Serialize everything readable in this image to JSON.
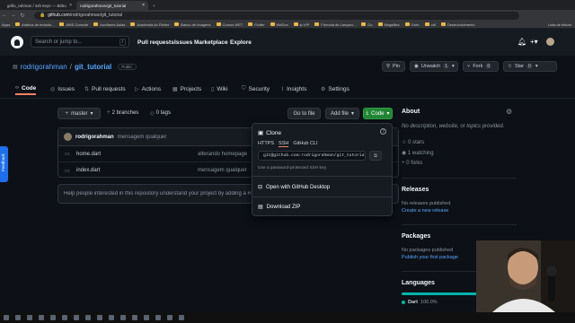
{
  "browser": {
    "tabs": [
      {
        "title": "grillo_rahman / ssh keys — Bitbu",
        "active": false
      },
      {
        "title": "rodrigorahman/git_tutorial",
        "active": true
      }
    ],
    "url_host": "github.com",
    "url_path": "/rodrigorahman/git_tutorial",
    "bookmarks": [
      "Apps",
      "Atalhos de teclado...",
      "AWS Console",
      "Auxiliares Aulas",
      "Academia do Flutter",
      "Banco de Imagens",
      "Cursos WET",
      "Flutter",
      "WeDox",
      "ip VIP",
      "Fórmula de Lançam...",
      "Go",
      "Megafiles",
      "Grêo",
      "old",
      "Desenvolvimento",
      "Lista de leitura"
    ]
  },
  "header": {
    "search_placeholder": "Search or jump to...",
    "search_kbd": "/",
    "nav": [
      "Pull requests",
      "Issues",
      "Marketplace",
      "Explore"
    ]
  },
  "repo": {
    "owner": "rodrigorahman",
    "sep": "/",
    "name": "git_tutorial",
    "visibility": "Public",
    "pin_label": "Pin",
    "unwatch_label": "Unwatch",
    "unwatch_count": "1",
    "fork_label": "Fork",
    "fork_count": "0",
    "star_label": "Star",
    "star_count": "0",
    "tabs": [
      "Code",
      "Issues",
      "Pull requests",
      "Actions",
      "Projects",
      "Wiki",
      "Security",
      "Insights",
      "Settings"
    ]
  },
  "toolbar": {
    "branch": "master",
    "branches": "2 branches",
    "tags": "0 tags",
    "go_to_file": "Go to file",
    "add_file": "Add file",
    "code": "Code"
  },
  "commit": {
    "author": "rodrigorahman",
    "message": "mensagem qualquer"
  },
  "files": [
    {
      "name": "home.dart",
      "message": "alterando homepage"
    },
    {
      "name": "index.dart",
      "message": "mensagem qualquer"
    }
  ],
  "readme_banner": "Help people interested in this repository understand your project by adding a README.",
  "clone": {
    "title": "Clone",
    "tabs": [
      "HTTPS",
      "SSH",
      "GitHub CLI"
    ],
    "active_tab": "SSH",
    "url": "git@github.com:rodrigorahman/git_tutorial",
    "note": "Use a password-protected SSH key.",
    "open_desktop": "Open with GitHub Desktop",
    "download_zip": "Download ZIP"
  },
  "sidebar": {
    "about_title": "About",
    "about_desc": "No description, website, or topics provided.",
    "stars": "0 stars",
    "watching": "1 watching",
    "forks": "0 forks",
    "releases_title": "Releases",
    "releases_none": "No releases published",
    "releases_link": "Create a new release",
    "packages_title": "Packages",
    "packages_none": "No packages published",
    "packages_link": "Publish your first package",
    "languages_title": "Languages",
    "language": "Dart",
    "language_pct": "100.0%",
    "language_fraction": 1.0,
    "language_color": "#00b4ab"
  },
  "feedback_label": "Feedback",
  "colors": {
    "accent_green": "#238636",
    "link_blue": "#58a6ff",
    "tab_underline": "#f78166"
  }
}
